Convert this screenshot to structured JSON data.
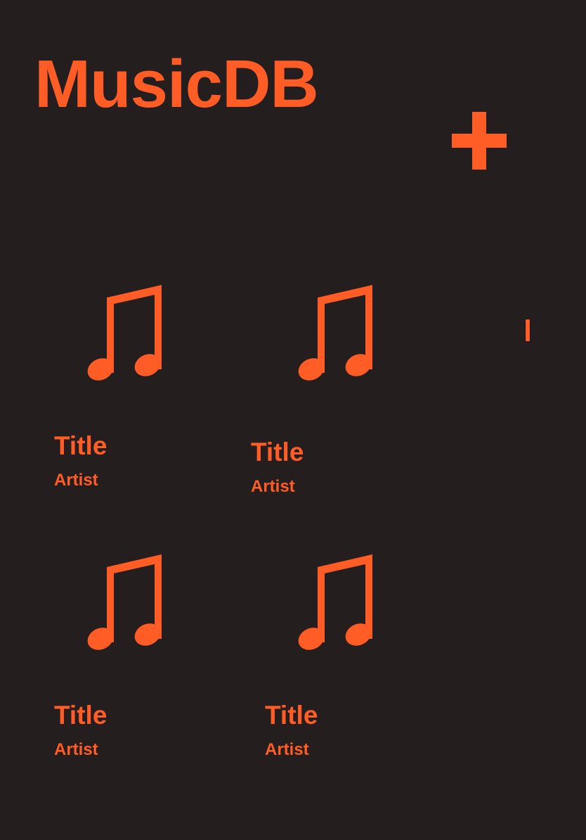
{
  "header": {
    "app_title": "MusicDB",
    "add_icon": "plus-icon"
  },
  "theme": {
    "background": "#251e1e",
    "accent": "#ff5c26"
  },
  "albums": [
    {
      "title": "Title",
      "artist": "Artist",
      "art_icon": "music-note-icon"
    },
    {
      "title": "Title",
      "artist": "Artist",
      "art_icon": "music-note-icon"
    },
    {
      "title": "Title",
      "artist": "Artist",
      "art_icon": "music-note-icon"
    },
    {
      "title": "Title",
      "artist": "Artist",
      "art_icon": "music-note-icon"
    }
  ]
}
